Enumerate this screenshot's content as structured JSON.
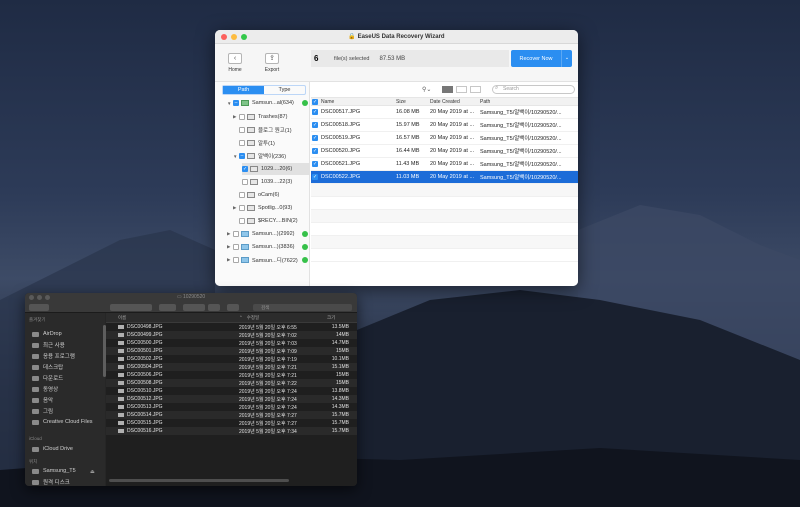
{
  "easeus": {
    "title": "EaseUS Data Recovery Wizard",
    "toolbar": {
      "home_label": "Home",
      "export_label": "Export",
      "home_glyph": "‹",
      "export_glyph": "⇪",
      "file_count": "6",
      "files_selected_label": "file(s) selected",
      "total_size": "87.53 MB",
      "recover_label": "Recover Now",
      "recover_dropdown": "⌄"
    },
    "tabs": [
      {
        "label": "Path",
        "active": true
      },
      {
        "label": "Type",
        "active": false
      }
    ],
    "tree": [
      {
        "label": "Samsun...al(634)",
        "expand": "▼",
        "checked": "partial",
        "icon": "drive",
        "ok": true
      },
      {
        "label": "Trashes(87)",
        "expand": "▶",
        "checked": false,
        "icon": "folder"
      },
      {
        "label": "블로그 원고(1)",
        "expand": "",
        "checked": false,
        "icon": "folder"
      },
      {
        "label": "알투(1)",
        "expand": "",
        "checked": false,
        "icon": "folder"
      },
      {
        "label": "알백이(236)",
        "expand": "▼",
        "checked": "partial",
        "icon": "folder"
      },
      {
        "label": "1029....20(6)",
        "expand": "",
        "checked": true,
        "icon": "folder"
      },
      {
        "label": "1039....22(3)",
        "expand": "",
        "checked": false,
        "icon": "folder"
      },
      {
        "label": "oCam(6)",
        "expand": "",
        "checked": false,
        "icon": "folder"
      },
      {
        "label": "Spotlig...0(93)",
        "expand": "▶",
        "checked": false,
        "icon": "folder"
      },
      {
        "label": "$RECY....BIN(2)",
        "expand": "",
        "checked": false,
        "icon": "folder"
      },
      {
        "label": "Samsun...)(2992)",
        "expand": "▶",
        "checked": false,
        "icon": "drive",
        "ok": true
      },
      {
        "label": "Samsun...)(3836)",
        "expand": "▶",
        "checked": false,
        "icon": "drive",
        "ok": true
      },
      {
        "label": "Samsun...디(7622)",
        "expand": "▶",
        "checked": false,
        "icon": "drive",
        "ok": true
      }
    ],
    "search_placeholder": "Search",
    "columns": {
      "name": "Name",
      "size": "Size",
      "date": "Date Created",
      "path": "Path"
    },
    "files": [
      {
        "name": "DSC00517.JPG",
        "size": "16.08 MB",
        "date": "20 May 2019 at ...",
        "path": "Samsung_T5/알백이/10290520/..."
      },
      {
        "name": "DSC00518.JPG",
        "size": "15.97 MB",
        "date": "20 May 2019 at ...",
        "path": "Samsung_T5/알백이/10290520/..."
      },
      {
        "name": "DSC00519.JPG",
        "size": "16.57 MB",
        "date": "20 May 2019 at ...",
        "path": "Samsung_T5/알백이/10290520/..."
      },
      {
        "name": "DSC00520.JPG",
        "size": "16.44 MB",
        "date": "20 May 2019 at ...",
        "path": "Samsung_T5/알백이/10290520/..."
      },
      {
        "name": "DSC00521.JPG",
        "size": "11.43 MB",
        "date": "20 May 2019 at ...",
        "path": "Samsung_T5/알백이/10290520/..."
      },
      {
        "name": "DSC00522.JPG",
        "size": "11.03 MB",
        "date": "20 May 2019 at ...",
        "path": "Samsung_T5/알백이/10290520/..."
      }
    ],
    "selected_index": 5,
    "colors": {
      "accent": "#2b8ef1",
      "selected_row": "#1c6cd8",
      "ok": "#37c14a"
    }
  },
  "finder": {
    "title": "10290520",
    "search_placeholder": "검색",
    "sidebar": {
      "favorites_label": "즐겨찾기",
      "favorites": [
        "AirDrop",
        "최근 사용",
        "응용 프로그램",
        "데스크탑",
        "다운로드",
        "동영상",
        "음악",
        "그림",
        "Creative Cloud Files"
      ],
      "icloud_label": "iCloud",
      "icloud": [
        "iCloud Drive"
      ],
      "locations_label": "위치",
      "locations": [
        "Samsung_T5",
        "원격 디스크"
      ],
      "eject_glyph": "⏏"
    },
    "columns": {
      "name": "이름",
      "modified": "수정일",
      "size": "크기",
      "sort_glyph": "⌃"
    },
    "files": [
      {
        "name": "DSC00498.JPG",
        "modified": "2019년 5월 20일 오후 6:55",
        "size": "13.5MB"
      },
      {
        "name": "DSC00499.JPG",
        "modified": "2019년 5월 20일 오후 7:02",
        "size": "14MB"
      },
      {
        "name": "DSC00500.JPG",
        "modified": "2019년 5월 20일 오후 7:03",
        "size": "14.7MB"
      },
      {
        "name": "DSC00501.JPG",
        "modified": "2019년 5월 20일 오후 7:09",
        "size": "15MB"
      },
      {
        "name": "DSC00502.JPG",
        "modified": "2019년 5월 20일 오후 7:19",
        "size": "10.1MB"
      },
      {
        "name": "DSC00504.JPG",
        "modified": "2019년 5월 20일 오후 7:21",
        "size": "15.1MB"
      },
      {
        "name": "DSC00506.JPG",
        "modified": "2019년 5월 20일 오후 7:21",
        "size": "15MB"
      },
      {
        "name": "DSC00508.JPG",
        "modified": "2019년 5월 20일 오후 7:22",
        "size": "15MB"
      },
      {
        "name": "DSC00510.JPG",
        "modified": "2019년 5월 20일 오후 7:24",
        "size": "13.8MB"
      },
      {
        "name": "DSC00512.JPG",
        "modified": "2019년 5월 20일 오후 7:24",
        "size": "14.3MB"
      },
      {
        "name": "DSC00513.JPG",
        "modified": "2019년 5월 20일 오후 7:24",
        "size": "14.3MB"
      },
      {
        "name": "DSC00514.JPG",
        "modified": "2019년 5월 20일 오후 7:27",
        "size": "15.7MB"
      },
      {
        "name": "DSC00515.JPG",
        "modified": "2019년 5월 20일 오후 7:27",
        "size": "15.7MB"
      },
      {
        "name": "DSC00516.JPG",
        "modified": "2019년 5월 20일 오후 7:34",
        "size": "15.7MB"
      }
    ]
  }
}
